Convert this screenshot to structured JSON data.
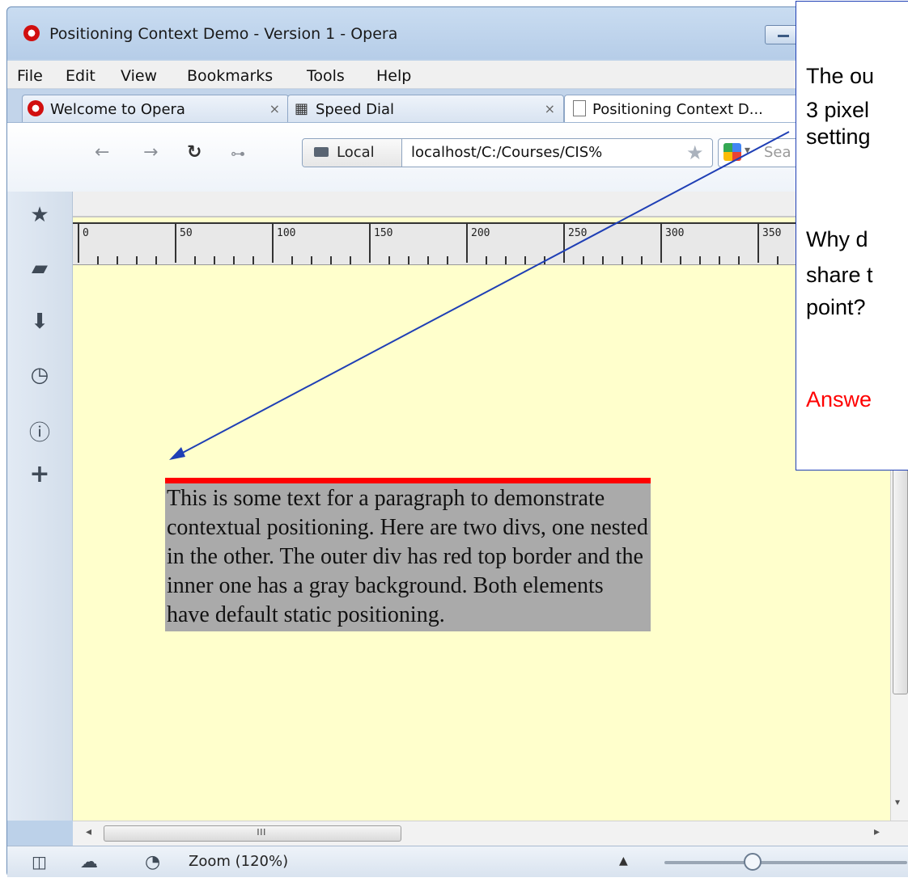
{
  "window": {
    "title": "Positioning Context Demo - Version 1 - Opera"
  },
  "menu": {
    "items": [
      "File",
      "Edit",
      "View",
      "Bookmarks",
      "Tools",
      "Help"
    ]
  },
  "tabs": [
    {
      "label": "Welcome to Opera",
      "icon": "opera-icon",
      "close": "×"
    },
    {
      "label": "Speed Dial",
      "icon": "speed-dial-icon",
      "close": "×"
    },
    {
      "label": "Positioning Context D...",
      "icon": "page-icon"
    }
  ],
  "toolbar": {
    "local_label": "Local",
    "url": "localhost/C:/Courses/CIS%",
    "search_placeholder": "Sea"
  },
  "ruler": {
    "labels": [
      "0",
      "50",
      "100",
      "150",
      "200",
      "250",
      "300",
      "350"
    ]
  },
  "page": {
    "paragraph": "This is some text for a paragraph to demonstrate contextual positioning. Here are two divs, one nested in the other. The outer div has red top border and the inner one has a gray background. Both elements have default static positioning."
  },
  "status": {
    "zoom": "Zoom (120%)",
    "zoom_percent": 120
  },
  "callout": {
    "line1": "The ou",
    "line2": "3 pixel",
    "line3": "setting",
    "line4": "Why d",
    "line5": "share t",
    "line6": "point?",
    "answer": "Answe"
  },
  "colors": {
    "border_top": "#ff0000",
    "inner_bg": "#aaaaaa",
    "page_bg": "#ffffcc",
    "callout_border": "#1f3fb5",
    "answer": "#ff0000"
  }
}
